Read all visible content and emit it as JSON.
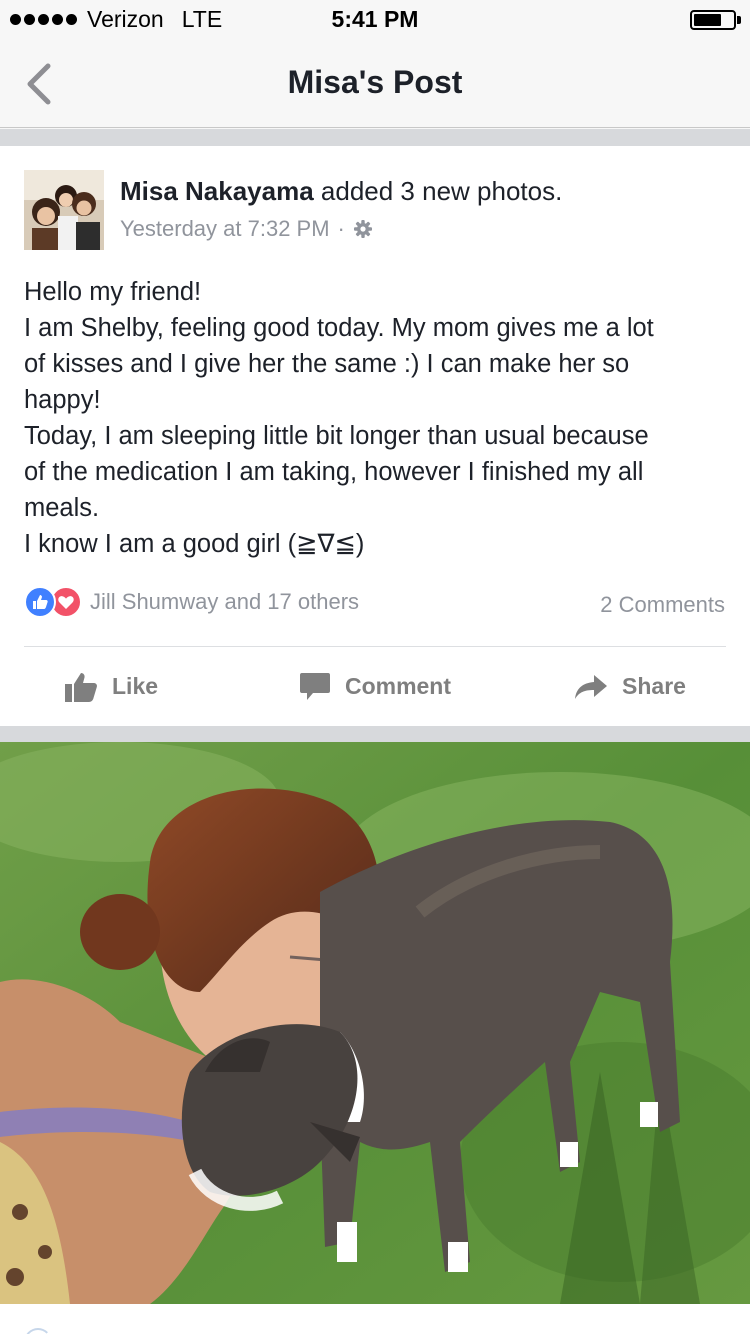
{
  "status_bar": {
    "carrier": "Verizon",
    "network": "LTE",
    "time": "5:41 PM",
    "battery_level": 0.7
  },
  "nav": {
    "title": "Misa's Post",
    "back_icon": "chevron-left-icon"
  },
  "post": {
    "author": "Misa Nakayama",
    "action_text": " added 3 new photos.",
    "timestamp": "Yesterday at 7:32 PM",
    "separator": "·",
    "privacy_icon": "gear-icon",
    "body_lines": [
      "Hello my friend!",
      "I am Shelby, feeling good today. My mom gives me a lot",
      "of kisses and I give her the same :) I can make her so",
      "happy!",
      "Today, I am sleeping little bit longer than usual because",
      "of the medication I am taking, however I finished my all",
      "meals.",
      "I know I am a good girl (≧∇≦)"
    ],
    "reactions_text": "Jill Shumway and 17 others",
    "comments_text": "2 Comments"
  },
  "actions": {
    "like": "Like",
    "comment": "Comment",
    "share": "Share"
  },
  "colors": {
    "accent_blue": "#4080ff",
    "love_red": "#f25268",
    "muted_text": "#90949c",
    "action_gray": "#7f7f7f",
    "separator_bg": "#d7d9dc"
  }
}
